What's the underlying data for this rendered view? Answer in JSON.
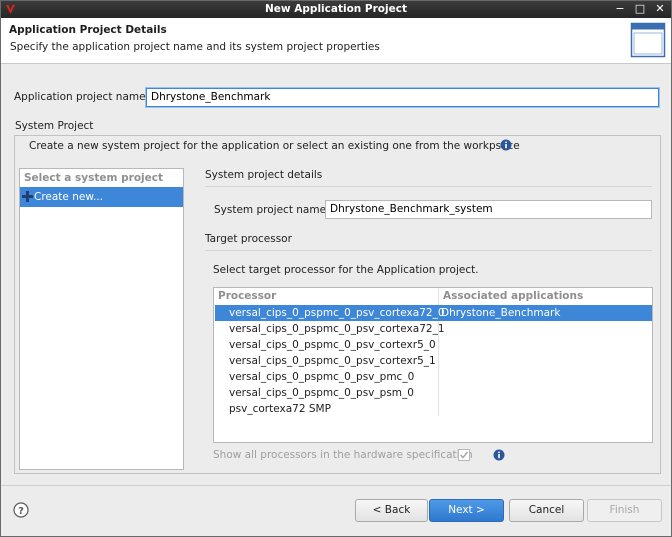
{
  "window": {
    "title": "New Application Project",
    "controls": {
      "minimize": "−",
      "maximize": "□",
      "close": "✕"
    }
  },
  "header": {
    "title": "Application Project Details",
    "description": "Specify the application project name and its system project properties"
  },
  "app_project": {
    "label": "Application project name:",
    "value": "Dhrystone_Benchmark"
  },
  "system_project": {
    "group_label": "System Project",
    "description": "Create a new system project for the application or select an existing one from the workpsace",
    "list": {
      "header": "Select a system project",
      "items": [
        "Create new..."
      ]
    },
    "details_heading": "System project details",
    "name_label": "System project name:",
    "name_value": "Dhrystone_Benchmark_system",
    "target_heading": "Target processor",
    "target_description": "Select target processor for the Application project.",
    "table": {
      "headers": [
        "Processor",
        "Associated applications"
      ],
      "rows": [
        {
          "processor": "versal_cips_0_pspmc_0_psv_cortexa72_0",
          "apps": "Dhrystone_Benchmark",
          "selected": true
        },
        {
          "processor": "versal_cips_0_pspmc_0_psv_cortexa72_1",
          "apps": ""
        },
        {
          "processor": "versal_cips_0_pspmc_0_psv_cortexr5_0",
          "apps": ""
        },
        {
          "processor": "versal_cips_0_pspmc_0_psv_cortexr5_1",
          "apps": ""
        },
        {
          "processor": "versal_cips_0_pspmc_0_psv_pmc_0",
          "apps": ""
        },
        {
          "processor": "versal_cips_0_pspmc_0_psv_psm_0",
          "apps": ""
        },
        {
          "processor": "psv_cortexa72 SMP",
          "apps": ""
        }
      ]
    },
    "show_all_label": "Show all processors in the hardware specification",
    "show_all_checked": true
  },
  "buttons": {
    "back": "< Back",
    "next": "Next >",
    "cancel": "Cancel",
    "finish": "Finish"
  },
  "colors": {
    "selection": "#3d86d8",
    "titlebar": "#2e2e2e",
    "info": "#2b579a"
  },
  "icons": {
    "help": "help-icon",
    "info": "info-icon",
    "wizard": "wizard-banner-icon",
    "add": "plus-icon"
  }
}
